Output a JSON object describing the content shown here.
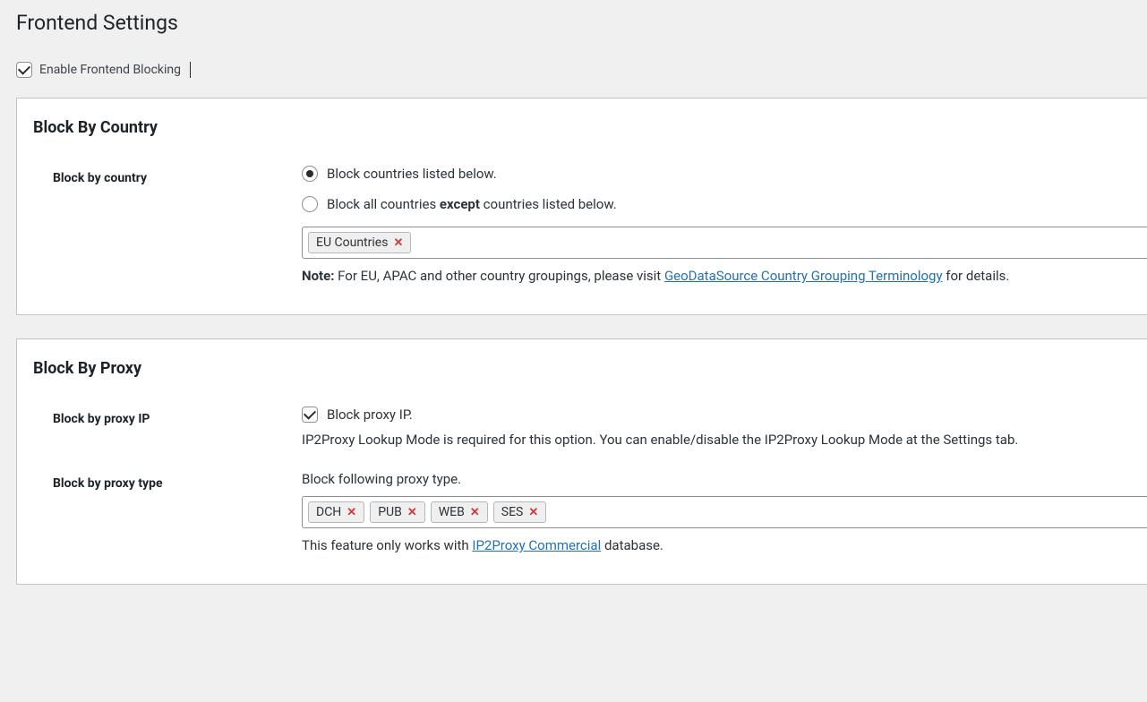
{
  "page_title": "Frontend Settings",
  "enable_checkbox_label": "Enable Frontend Blocking",
  "enable_checked": true,
  "block_country": {
    "section_title": "Block By Country",
    "label": "Block by country",
    "radio1": "Block countries listed below.",
    "radio2_pre": "Block all countries ",
    "radio2_bold": "except",
    "radio2_post": " countries listed below.",
    "tags": [
      "EU Countries"
    ],
    "note_bold": "Note:",
    "note_pre": " For EU, APAC and other country groupings, please visit ",
    "note_link": "GeoDataSource Country Grouping Terminology",
    "note_post": " for details."
  },
  "block_proxy": {
    "section_title": "Block By Proxy",
    "ip_label": "Block by proxy IP",
    "ip_check_label": "Block proxy IP.",
    "ip_helper": "IP2Proxy Lookup Mode is required for this option. You can enable/disable the IP2Proxy Lookup Mode at the Settings tab.",
    "type_label": "Block by proxy type",
    "type_intro": "Block following proxy type.",
    "type_tags": [
      "DCH",
      "PUB",
      "WEB",
      "SES"
    ],
    "type_note_pre": "This feature only works with ",
    "type_note_link": "IP2Proxy Commercial",
    "type_note_post": " database."
  }
}
